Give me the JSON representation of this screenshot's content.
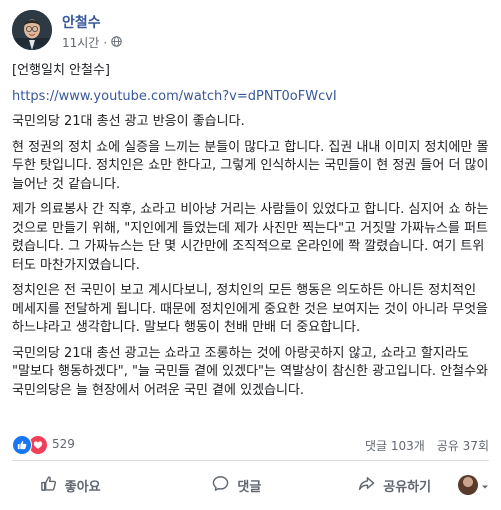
{
  "post": {
    "author": "안철수",
    "time": "11시간",
    "body": {
      "p1": "[언행일치 안철수]",
      "link": "https://www.youtube.com/watch?v=dPNT0oFWcvI",
      "p2": "국민의당 21대 총선 광고 반응이 좋습니다.",
      "p3": "현 정권의 정치 쇼에 실증을 느끼는 분들이 많다고 합니다. 집권 내내 이미지 정치에만 몰두한 탓입니다. 정치인은 쇼만 한다고, 그렇게 인식하시는 국민들이 현 정권 들어 더 많이 늘어난 것 같습니다.",
      "p4": "제가 의료봉사 간 직후, 쇼라고 비아냥 거리는 사람들이 있었다고 합니다. 심지어 쇼 하는 것으로 만들기 위해, \"지인에게 들었는데 제가 사진만 찍는다\"고 거짓말 가짜뉴스를 퍼트렸습니다. 그 가짜뉴스는 단 몇 시간만에 조직적으로 온라인에 쫙 깔렸습니다. 여기 트위터도 마찬가지였습니다.",
      "p5": "정치인은 전 국민이 보고 계시다보니, 정치인의 모든 행동은 의도하든 아니든 정치적인 메세지를 전달하게 됩니다. 때문에 정치인에게 중요한 것은 보여지는 것이 아니라 무엇을 하느냐라고 생각합니다. 말보다 행동이 천배 만배 더 중요합니다.",
      "p6": "국민의당 21대 총선 광고는 쇼라고 조롱하는 것에 아랑곳하지 않고, 쇼라고 할지라도 \"말보다 행동하겠다\", \"늘 국민들 곁에 있겠다\"는 역발상이 참신한 광고입니다. 안철수와 국민의당은 늘 현장에서 어려운 국민 곁에 있겠습니다."
    }
  },
  "stats": {
    "reactions": "529",
    "comments": "댓글 103개",
    "shares": "공유 37회"
  },
  "actions": {
    "like": "좋아요",
    "comment": "댓글",
    "share": "공유하기"
  },
  "icons": {
    "privacy": "globe-icon",
    "like_reaction": "thumbs-up-icon",
    "love_reaction": "heart-icon"
  },
  "colors": {
    "link": "#385898",
    "like": "#1877f2",
    "love": "#f33e58"
  }
}
